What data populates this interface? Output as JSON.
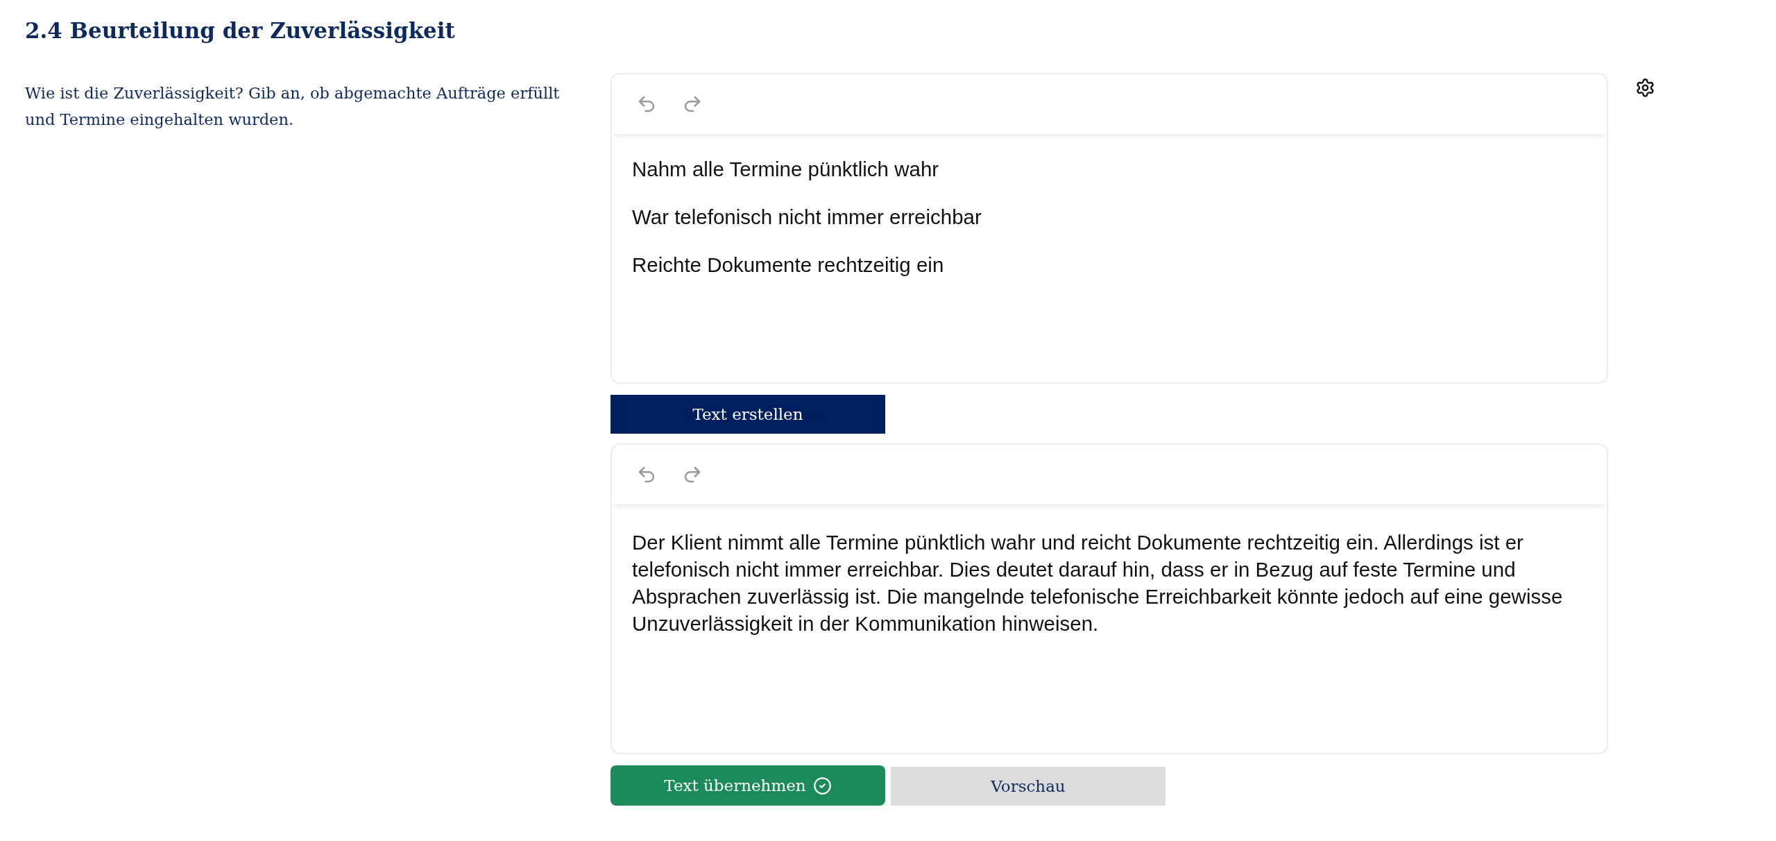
{
  "heading": {
    "title": "2.4 Beurteilung der Zuverlässigkeit"
  },
  "question": {
    "text": "Wie ist die Zuverlässigkeit? Gib an, ob abgemachte Aufträge erfüllt und Termine eingehalten wurden."
  },
  "input_editor": {
    "paragraphs": [
      "Nahm alle Termine pünktlich wahr",
      "War telefonisch nicht immer erreichbar",
      "Reichte Dokumente rechtzeitig ein"
    ]
  },
  "generate_button": {
    "label": "Text erstellen"
  },
  "output_editor": {
    "paragraphs": [
      "Der Klient nimmt alle Termine pünktlich wahr und reicht Dokumente rechtzeitig ein. Allerdings ist er telefonisch nicht immer erreichbar. Dies deutet darauf hin, dass er in Bezug auf feste Termine und Absprachen zuverlässig ist. Die mangelnde telefonische Erreichbarkeit könnte jedoch auf eine gewisse Unzuverlässigkeit in der Kommunikation hinweisen."
    ]
  },
  "actions": [
    {
      "kind": "accept",
      "label": "Text übernehmen"
    },
    {
      "kind": "preview",
      "label": "Vorschau"
    }
  ]
}
